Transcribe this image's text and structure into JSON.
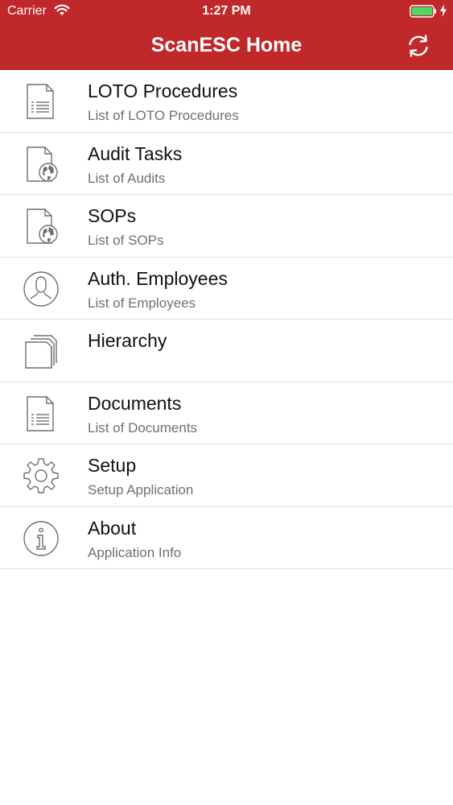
{
  "status_bar": {
    "carrier": "Carrier",
    "time": "1:27 PM"
  },
  "nav": {
    "title": "ScanESC Home"
  },
  "colors": {
    "header": "#c0282a",
    "battery": "#4cd964",
    "icon_stroke": "#6f6f6f"
  },
  "menu": [
    {
      "title": "LOTO Procedures",
      "subtitle": "List of LOTO Procedures",
      "icon": "document-list-icon"
    },
    {
      "title": "Audit Tasks",
      "subtitle": "List of Audits",
      "icon": "document-globe-icon"
    },
    {
      "title": "SOPs",
      "subtitle": "List of SOPs",
      "icon": "document-globe-icon"
    },
    {
      "title": "Auth. Employees",
      "subtitle": "List of Employees",
      "icon": "person-circle-icon"
    },
    {
      "title": "Hierarchy",
      "subtitle": "",
      "icon": "folders-stack-icon"
    },
    {
      "title": "Documents",
      "subtitle": "List of Documents",
      "icon": "document-list-icon"
    },
    {
      "title": "Setup",
      "subtitle": "Setup Application",
      "icon": "gear-icon"
    },
    {
      "title": "About",
      "subtitle": "Application Info",
      "icon": "info-circle-icon"
    }
  ]
}
